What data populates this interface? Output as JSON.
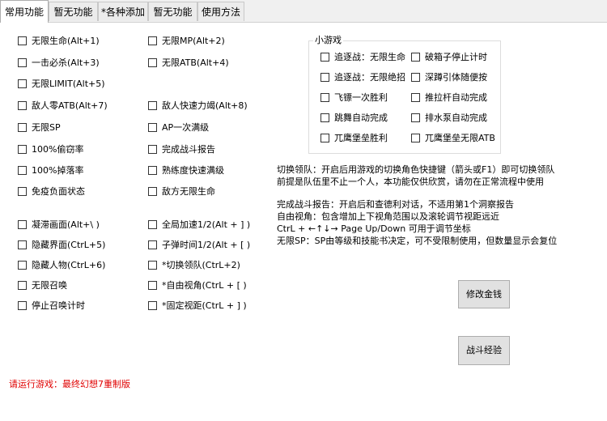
{
  "tabs": [
    "常用功能",
    "暂无功能",
    "*各种添加",
    "暂无功能",
    "使用方法"
  ],
  "left_col": [
    "无限生命(Alt+1)",
    "一击必杀(Alt+3)",
    "无限LIMIT(Alt+5)",
    "敌人零ATB(Alt+7)",
    "无限SP",
    "100%偷窃率",
    "100%掉落率",
    "免疫负面状态",
    "凝滞画面(Alt+\\ )",
    "隐藏界面(CtrL+5)",
    "隐藏人物(CtrL+6)",
    "无限召唤",
    "停止召唤计时"
  ],
  "right_col": [
    "无限MP(Alt+2)",
    "无限ATB(Alt+4)",
    "敌人快速力竭(Alt+8)",
    "AP一次满级",
    "完成战斗报告",
    "熟练度快速满级",
    "敌方无限生命",
    "全局加速1/2(Alt + ] )",
    "子弹时间1/2(Alt + [ )",
    "*切换领队(CtrL+2)",
    "*自由视角(CtrL + [ )",
    "*固定视距(CtrL + ] )"
  ],
  "minigame": {
    "title": "小游戏",
    "items": [
      "追逐战：无限生命",
      "破箱子停止计时",
      "追逐战：无限绝招",
      "深蹲引体随便按",
      "飞镖一次胜利",
      "推拉杆自动完成",
      "跳舞自动完成",
      "排水泵自动完成",
      "兀鹰堡垒胜利",
      "兀鹰堡垒无限ATB"
    ]
  },
  "info": [
    "切换领队：开启后用游戏的切换角色快捷键（箭头或F1）即可切换领队",
    "前提是队伍里不止一个人，本功能仅供欣赏，请勿在正常流程中使用",
    "完成战斗报告：开启后和查德利对话，不适用第1个洞察报告",
    "自由视角：包含增加上下视角范围以及滚轮调节视距远近",
    "CtrL + ←↑↓→  Page Up/Down 可用于调节坐标",
    "无限SP：SP由等级和技能书决定，可不受限制使用，但数量显示会复位"
  ],
  "buttons": {
    "money": "修改金钱",
    "exp": "战斗经验"
  },
  "status": "请运行游戏：最终幻想7重制版"
}
